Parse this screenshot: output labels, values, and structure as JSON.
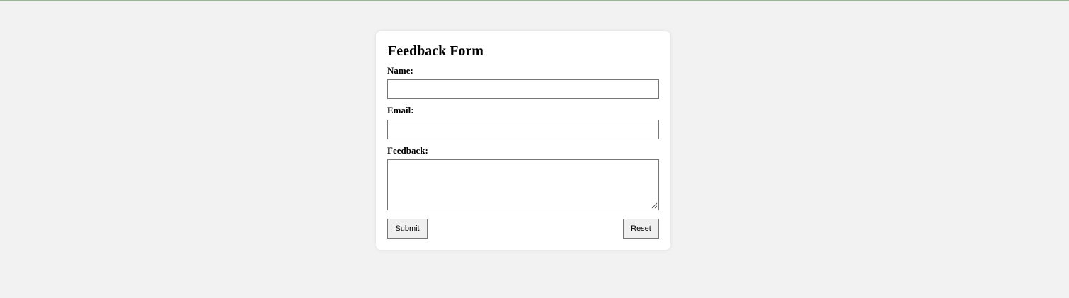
{
  "form": {
    "title": "Feedback Form",
    "name_label": "Name:",
    "name_value": "",
    "email_label": "Email:",
    "email_value": "",
    "feedback_label": "Feedback:",
    "feedback_value": "",
    "submit_label": "Submit",
    "reset_label": "Reset"
  },
  "colors": {
    "page_background": "#f2f2f2",
    "card_background": "#ffffff",
    "top_border": "#9fb59b",
    "input_border": "#767676",
    "button_background": "#efefef"
  }
}
